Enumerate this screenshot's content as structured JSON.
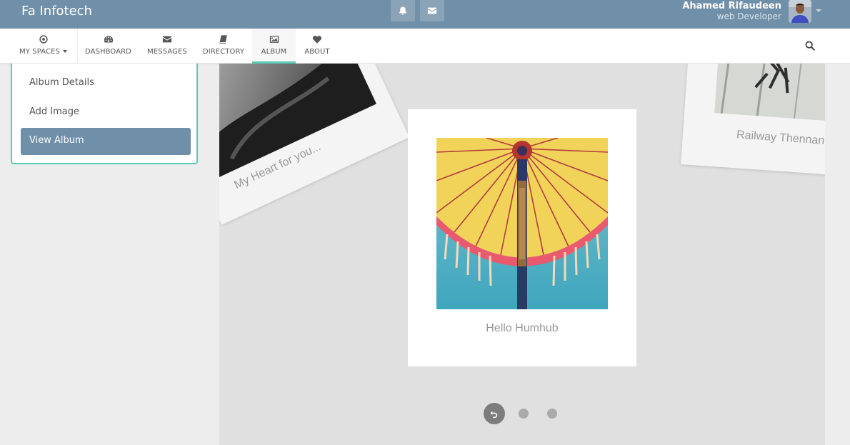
{
  "brand": "Fa Infotech",
  "user": {
    "name": "Ahamed Rifaudeen",
    "title": "web Developer"
  },
  "nav": {
    "my_spaces": "MY SPACES",
    "dashboard": "DASHBOARD",
    "messages": "MESSAGES",
    "directory": "DIRECTORY",
    "album": "ALBUM",
    "about": "ABOUT"
  },
  "sidebar": {
    "items": [
      {
        "label": "Album Details"
      },
      {
        "label": "Add Image"
      },
      {
        "label": "View Album"
      }
    ]
  },
  "album": {
    "cards": [
      {
        "caption": "My Heart for you..."
      },
      {
        "caption": "Hello Humhub"
      },
      {
        "caption": "Railway Thennanthoppu"
      }
    ]
  },
  "colors": {
    "header": "#708fa8",
    "accent": "#5ccbb4"
  },
  "icons": [
    "bell-icon",
    "envelope-icon",
    "target-icon",
    "dashboard-icon",
    "book-icon",
    "image-icon",
    "heart-icon",
    "search-icon",
    "undo-icon"
  ]
}
